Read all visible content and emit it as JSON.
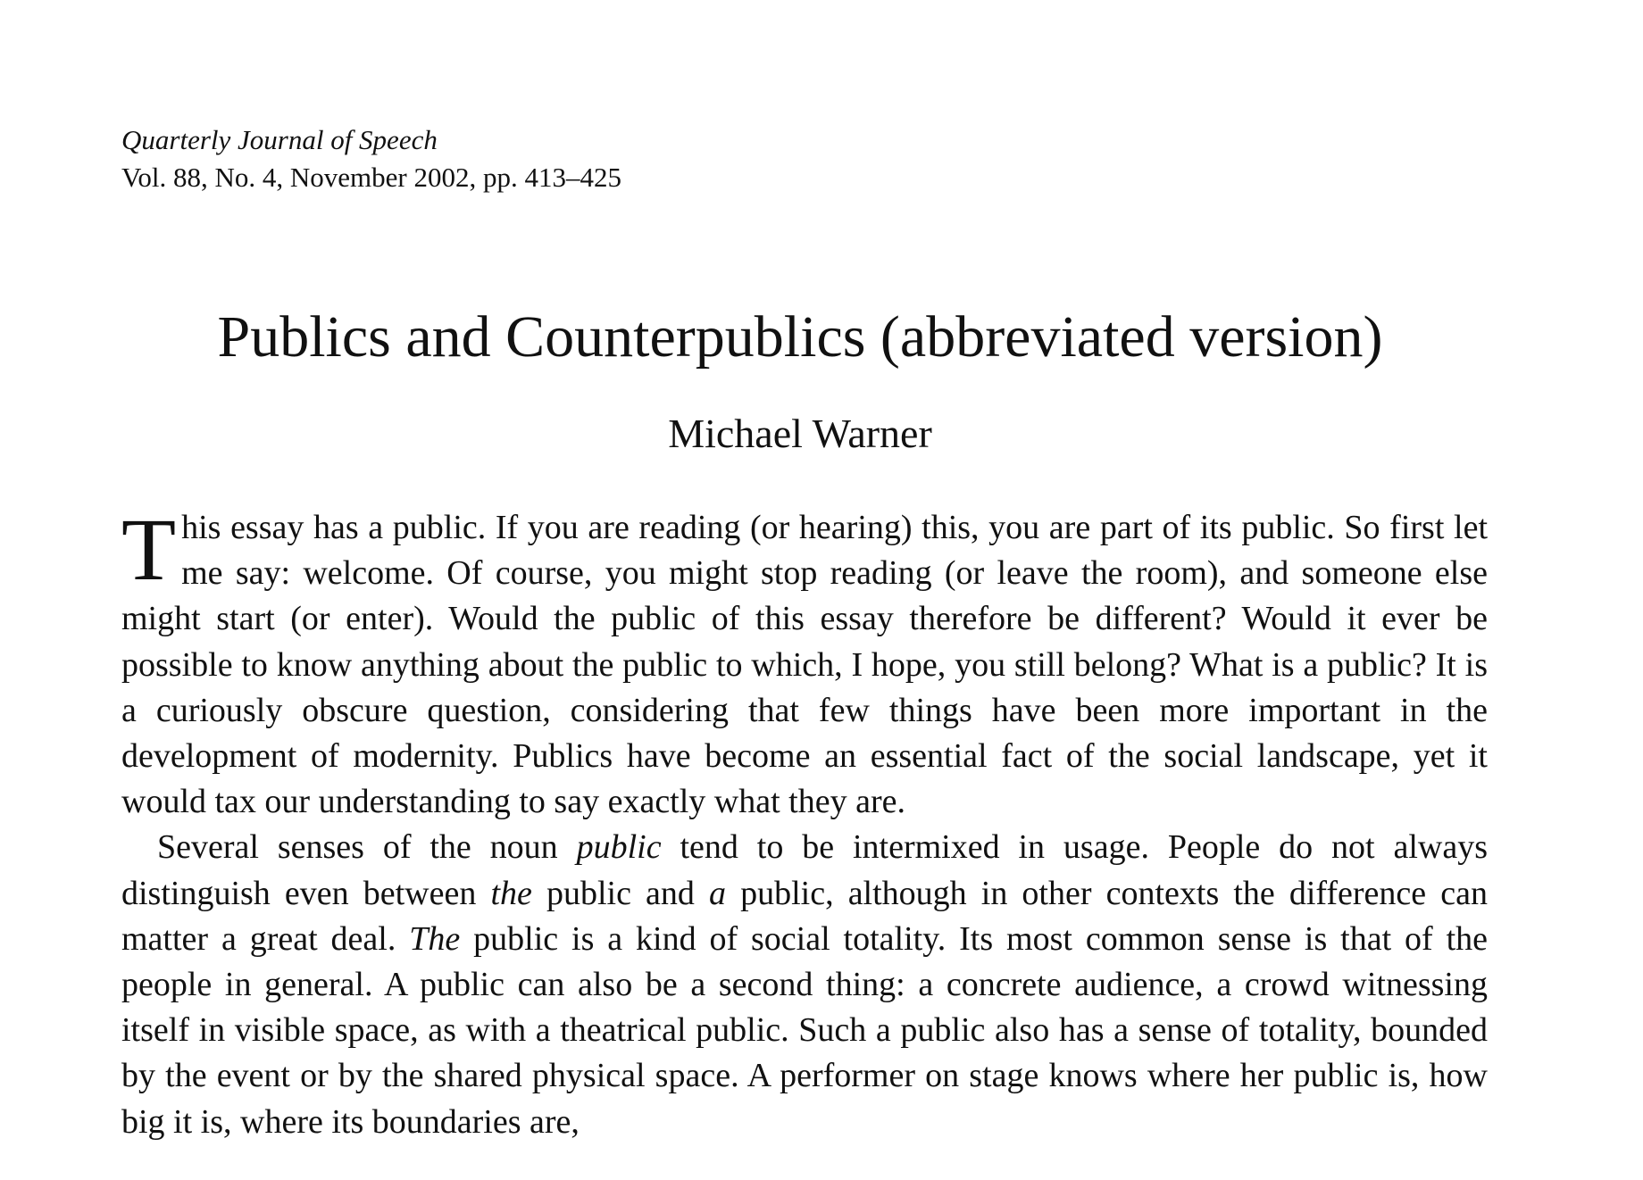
{
  "header": {
    "journal_name": "Quarterly Journal of Speech",
    "citation": "Vol. 88, No. 4, November 2002, pp. 413–425"
  },
  "article": {
    "title": "Publics and Counterpublics (abbreviated version)",
    "author": "Michael Warner"
  },
  "body": {
    "paragraph1": {
      "dropcap": "T",
      "text": "his essay has a public. If you are reading (or hearing) this, you are part of its public. So first let me say: welcome. Of course, you might stop reading (or leave the room), and someone else might start (or enter). Would the public of this essay therefore be different? Would it ever be possible to know anything about the public to which, I hope, you still belong? What is a public? It is a curiously obscure question, considering that few things have been more important in the development of modernity. Publics have become an essential fact of the social landscape, yet it would tax our understanding to say exactly what they are."
    },
    "paragraph2": {
      "segments": [
        "Several senses of the noun ",
        "public",
        " tend to be intermixed in usage. People do not always distinguish even between ",
        "the",
        " public and ",
        "a",
        " public, although in other contexts the difference can matter a great deal. ",
        "The",
        " public is a kind of social totality. Its most common sense is that of the people in general. A public can also be a second thing: a concrete audience, a crowd witnessing itself in visible space, as with a theatrical public. Such a public also has a sense of totality, bounded by the event or by the shared physical space. A performer on stage knows where her public is, how big it is, where its boundaries are,"
      ]
    }
  }
}
